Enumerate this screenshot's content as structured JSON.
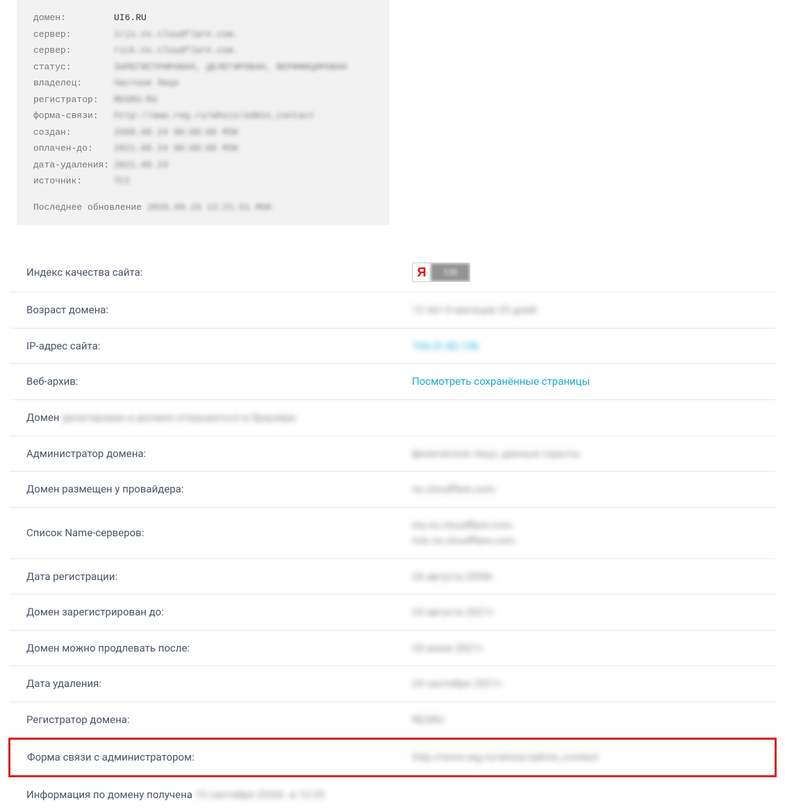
{
  "whois": {
    "rows": [
      {
        "label": "домен:",
        "value": "UI6.RU",
        "clear": true
      },
      {
        "label": "сервер:",
        "value": "iris.ns.cloudflare.com."
      },
      {
        "label": "сервер:",
        "value": "rick.ns.cloudflare.com."
      },
      {
        "label": "статус:",
        "value": "ЗАРЕГИСТРИРОВАН, ДЕЛЕГИРОВАН, ВЕРИФИЦИРОВАН"
      },
      {
        "label": "владелец:",
        "value": "Частное Лицо"
      },
      {
        "label": "регистратор:",
        "value": "REGRU-RU"
      },
      {
        "label": "форма-связи:",
        "value": "http://www.reg.ru/whois/admin_contact"
      },
      {
        "label": "создан:",
        "value": "2008.08.24 00:00:00 MSK"
      },
      {
        "label": "оплачен-до:",
        "value": "2021.08.24 00:00:00 MSK"
      },
      {
        "label": "дата-удаления:",
        "value": "2021.09.24"
      },
      {
        "label": "источник:",
        "value": "TCI"
      }
    ],
    "footer_prefix": "Последнее обновление ",
    "footer_date": "2020.09.15 12:21:51 MSK"
  },
  "info": {
    "quality_label": "Индекс качества сайта:",
    "yandex_letter": "Я",
    "yandex_score": "120",
    "age_label": "Возраст домена:",
    "age_value": "12 лет 0 месяцев 25 дней",
    "ip_label": "IP-адрес сайта:",
    "ip_value": "104.31.82.136",
    "archive_label": "Веб-архив:",
    "archive_link": "Посмотреть сохранённые страницы",
    "domain_prefix": "Домен ",
    "domain_rest": "делегирован и должен открываться в браузере.",
    "admin_label": "Администратор домена:",
    "admin_value": "физическое лицо, данные скрыты",
    "provider_label": "Домен размещен у провайдера:",
    "provider_value": "ns.cloudflare.com",
    "ns_label": "Список Name-серверов:",
    "ns1": "iris.ns.cloudflare.com.",
    "ns2": "rick.ns.cloudflare.com.",
    "regdate_label": "Дата регистрации:",
    "regdate_value": "24 августа 2008г.",
    "until_label": "Домен зарегистрирован до:",
    "until_value": "24 августа 2021г.",
    "renew_label": "Домен можно продлевать после:",
    "renew_value": "25 июня 2021г.",
    "delete_label": "Дата удаления:",
    "delete_value": "24 сентября 2021г.",
    "registrar_label": "Регистратор домена:",
    "registrar_value": "REGRU",
    "contact_label": "Форма связи с администратором:",
    "contact_value": "http://www.reg.ru/whois/admin_contact",
    "received_prefix": "Информация по домену получена ",
    "received_value": "15 сентября 2020г. в 12:25"
  }
}
